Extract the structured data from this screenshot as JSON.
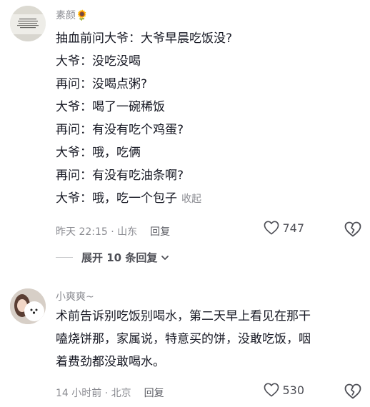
{
  "comments": [
    {
      "username": "素颜🌻",
      "lines": [
        "抽血前问大爷：大爷早晨吃饭没?",
        "大爷：没吃没喝",
        "再问：没喝点粥?",
        "大爷：喝了一碗稀饭",
        "再问：有没有吃个鸡蛋?",
        "大爷：哦，吃俩",
        "再问：有没有吃油条啊?",
        "大爷：哦，吃一个包子"
      ],
      "fold_label": "收起",
      "time_location": "昨天 22:15 · 山东",
      "reply_label": "回复",
      "likes": "747",
      "expand_label": "展开 10 条回复"
    },
    {
      "username": "小爽爽~",
      "lines": [
        "术前告诉别吃饭别喝水，第二天早上看见在那干",
        "嗑烧饼那，家属说，特意买的饼，没敢吃饭，咽",
        "着费劲都没敢喝水。"
      ],
      "time_location": "14 小时前 · 北京",
      "reply_label": "回复",
      "likes": "530"
    }
  ],
  "icons": {
    "like": "heart-outline-icon",
    "dislike": "broken-heart-icon",
    "expand": "chevron-down-icon"
  },
  "colors": {
    "text": "#161823",
    "secondary": "#8a8b91"
  }
}
